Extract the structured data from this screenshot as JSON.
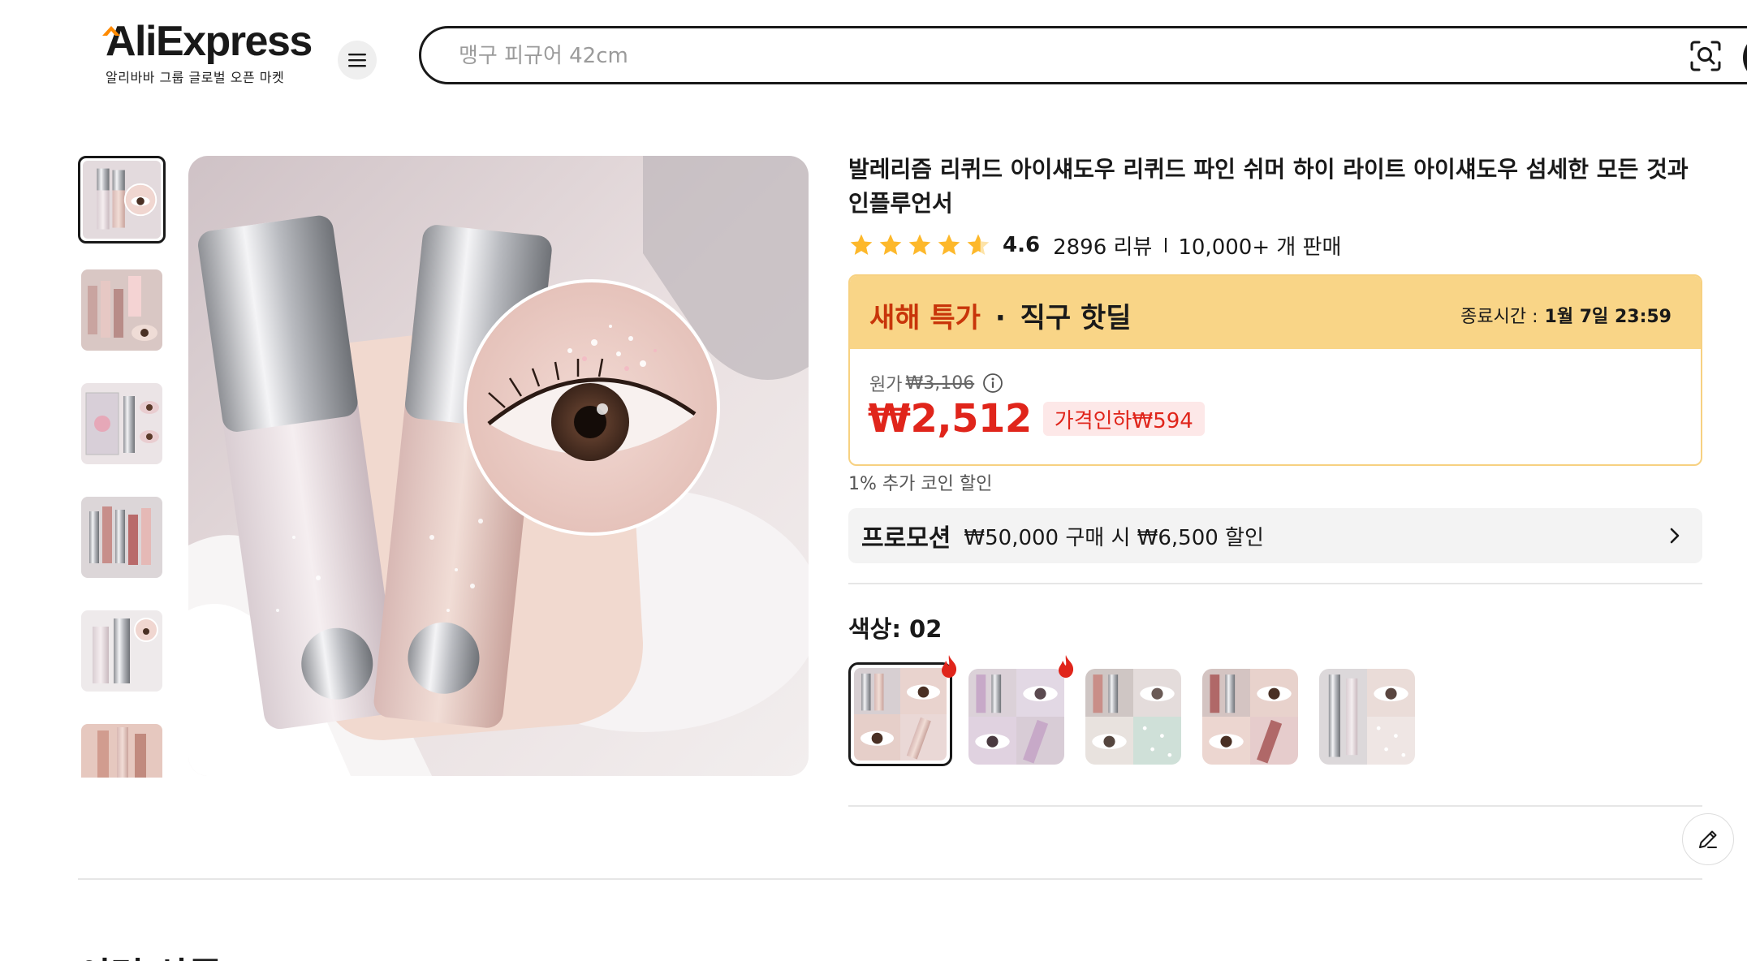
{
  "header": {
    "logo_text": "AliExpress",
    "logo_tagline": "알리바바 그룹 글로벌 오픈 마켓",
    "menu_icon": "hamburger-icon",
    "search": {
      "placeholder": "맹구 피규어 42cm",
      "camera_icon": "image-search-icon"
    }
  },
  "gallery": {
    "thumbnail_count": 6,
    "active_index": 0
  },
  "product": {
    "title": "발레리즘 리퀴드 아이섀도우 리퀴드 파인 쉬머 하이 라이트 아이섀도우 섬세한 모든 것과 인플루언서",
    "rating": "4.6",
    "reviews": "2896 리뷰",
    "sold": "10,000+ 개 판매",
    "star_fill": 4.6
  },
  "deal": {
    "label_red": "새해 특가",
    "label_dot": "·",
    "label_black": "직구 핫딜",
    "end_label": "종료시간 :",
    "end_time": "1월 7일 23:59",
    "original_label": "원가",
    "original_price": "₩3,106",
    "price": "₩2,512",
    "discount": "가격인하₩594"
  },
  "coin_note": "1% 추가 코인 할인",
  "promotion": {
    "title": "프로모션",
    "text": "₩50,000 구매 시 ₩6,500 할인"
  },
  "color": {
    "label": "색상: 02",
    "selected_index": 0,
    "hot_indices": [
      0,
      1
    ]
  },
  "recommend_title": "이런 상품",
  "colors": {
    "accent_red": "#e0251b",
    "deal_yellow": "#f9d587",
    "deal_red_text": "#c8350a",
    "star": "#fdb82b"
  }
}
